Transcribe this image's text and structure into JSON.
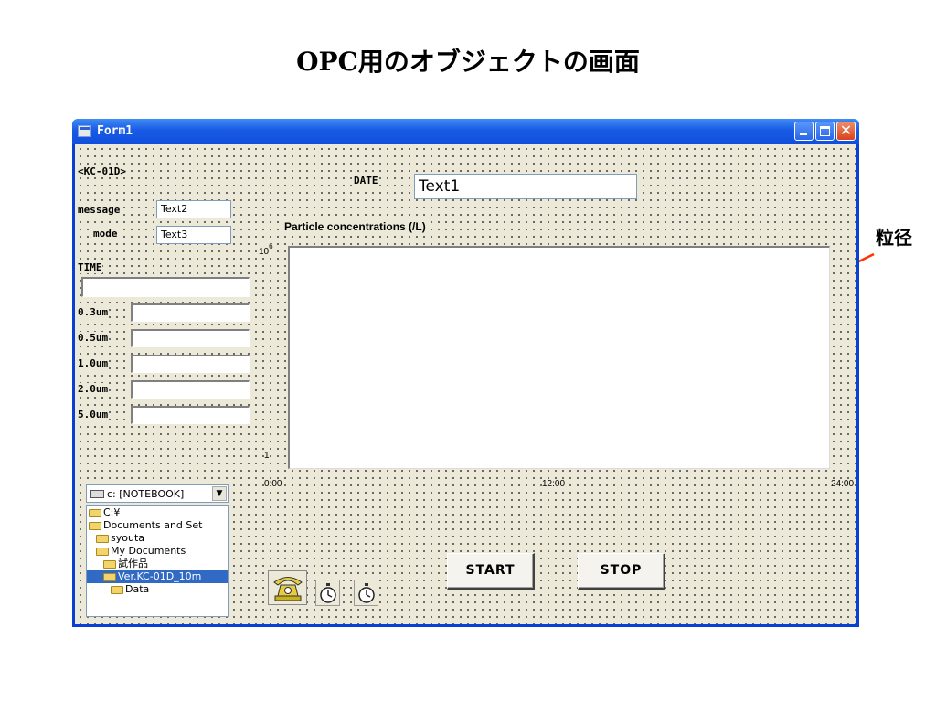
{
  "slide": {
    "title": "OPC用のオブジェクトの画面",
    "side_label": "粒径",
    "pointer_color": "#ff3300"
  },
  "window": {
    "title": "Form1",
    "controls": {
      "minimize": "minimize-icon",
      "maximize": "maximize-icon",
      "close": "close-icon"
    }
  },
  "form": {
    "device_label": "<KC-01D>",
    "message_label": "message",
    "message_value": "Text2",
    "mode_label": "mode",
    "mode_value": "Text3",
    "time_label": "TIME",
    "time_value": "",
    "date_label": "DATE",
    "date_value": "Text1",
    "sizes": [
      {
        "label": "0.3um",
        "value": ""
      },
      {
        "label": "0.5um",
        "value": ""
      },
      {
        "label": "1.0um",
        "value": ""
      },
      {
        "label": "2.0um",
        "value": ""
      },
      {
        "label": "5.0um",
        "value": ""
      }
    ]
  },
  "chart_data": {
    "type": "line",
    "title": "Particle concentrations (/L)",
    "series": [],
    "y_scale": "log",
    "ylim": [
      1,
      1000000
    ],
    "y_top_label": {
      "base": "10",
      "exp": "6"
    },
    "y_bottom_label": "1",
    "x_ticks": [
      "0:00",
      "12:00",
      "24:00"
    ],
    "grid": false
  },
  "file_browser": {
    "drive": "c: [NOTEBOOK]",
    "dirs": [
      {
        "label": "C:¥",
        "depth": 0,
        "selected": false
      },
      {
        "label": "Documents and Set",
        "depth": 0,
        "selected": false
      },
      {
        "label": "syouta",
        "depth": 1,
        "selected": false
      },
      {
        "label": "My Documents",
        "depth": 1,
        "selected": false
      },
      {
        "label": "試作品",
        "depth": 2,
        "selected": false
      },
      {
        "label": "Ver.KC-01D_10m",
        "depth": 2,
        "selected": true
      },
      {
        "label": "Data",
        "depth": 3,
        "selected": false
      }
    ]
  },
  "buttons": {
    "start": "START",
    "stop": "STOP"
  },
  "icons": {
    "comm": "telephone-icon",
    "timer1": "stopwatch-icon",
    "timer2": "stopwatch-icon"
  }
}
